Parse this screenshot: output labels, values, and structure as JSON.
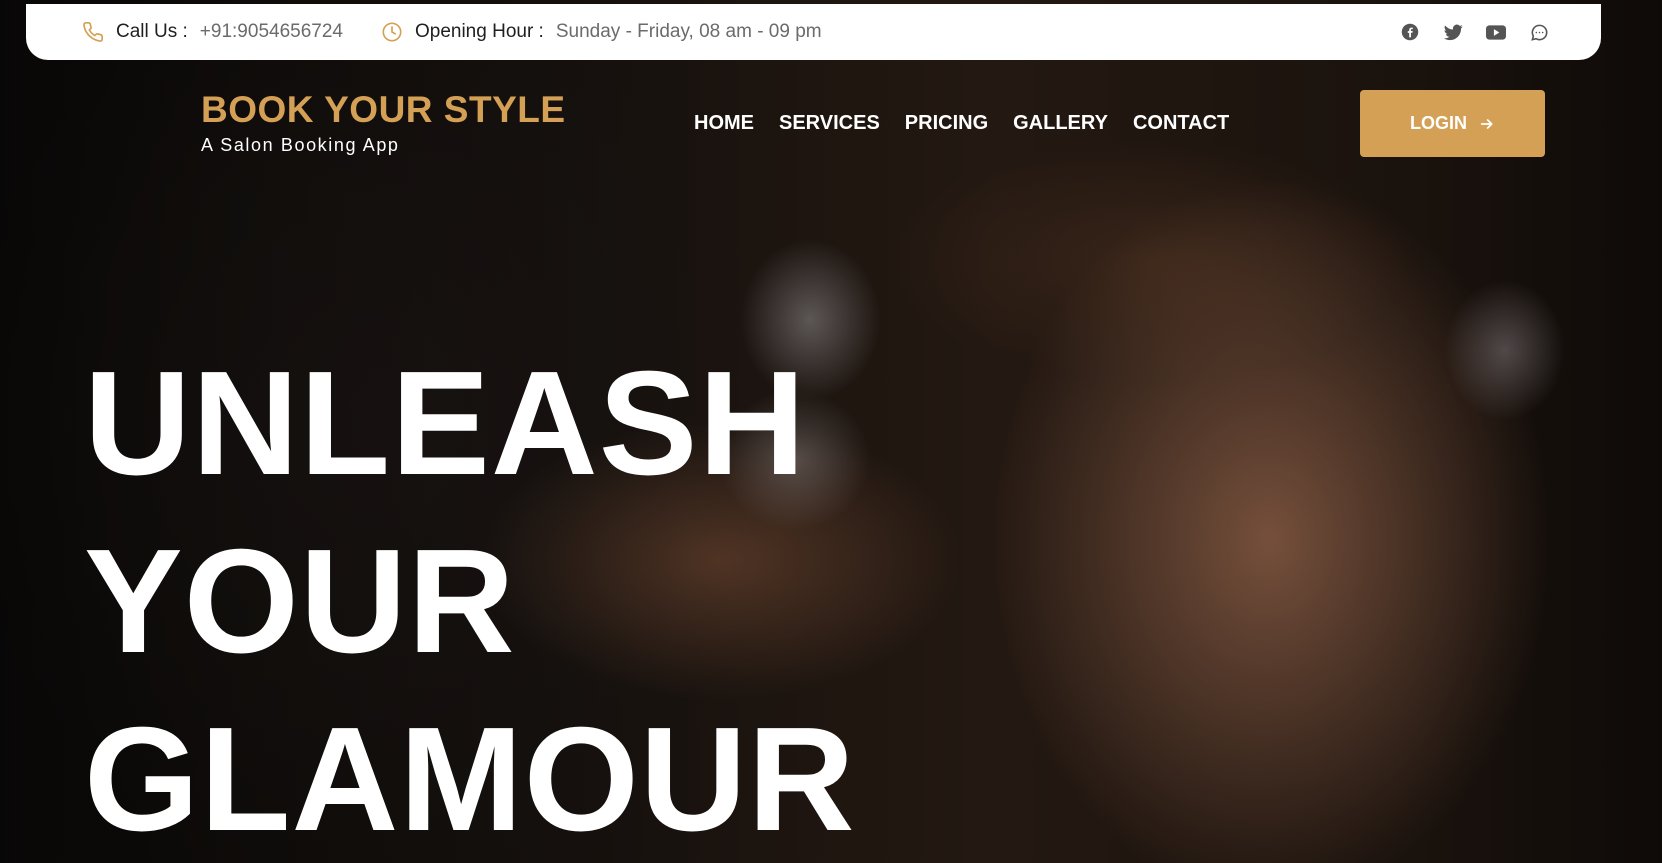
{
  "topbar": {
    "call_label": "Call Us :",
    "call_value": "+91:9054656724",
    "hours_label": "Opening Hour :",
    "hours_value": "Sunday - Friday, 08 am - 09 pm",
    "social_icons": [
      "facebook-icon",
      "twitter-icon",
      "youtube-icon",
      "chat-icon"
    ]
  },
  "brand": {
    "title": "BOOK YOUR STYLE",
    "subtitle": "A Salon Booking App"
  },
  "nav": {
    "items": [
      {
        "label": "HOME"
      },
      {
        "label": "SERVICES"
      },
      {
        "label": "PRICING"
      },
      {
        "label": "GALLERY"
      },
      {
        "label": "CONTACT"
      }
    ],
    "login_label": "LOGIN"
  },
  "hero": {
    "headline_lines": [
      "UNLEASH",
      "YOUR",
      "GLAMOUR"
    ]
  },
  "colors": {
    "accent": "#d4a055",
    "topbar_bg": "#ffffff",
    "text_light": "#ffffff",
    "icon_gray": "#555555"
  }
}
